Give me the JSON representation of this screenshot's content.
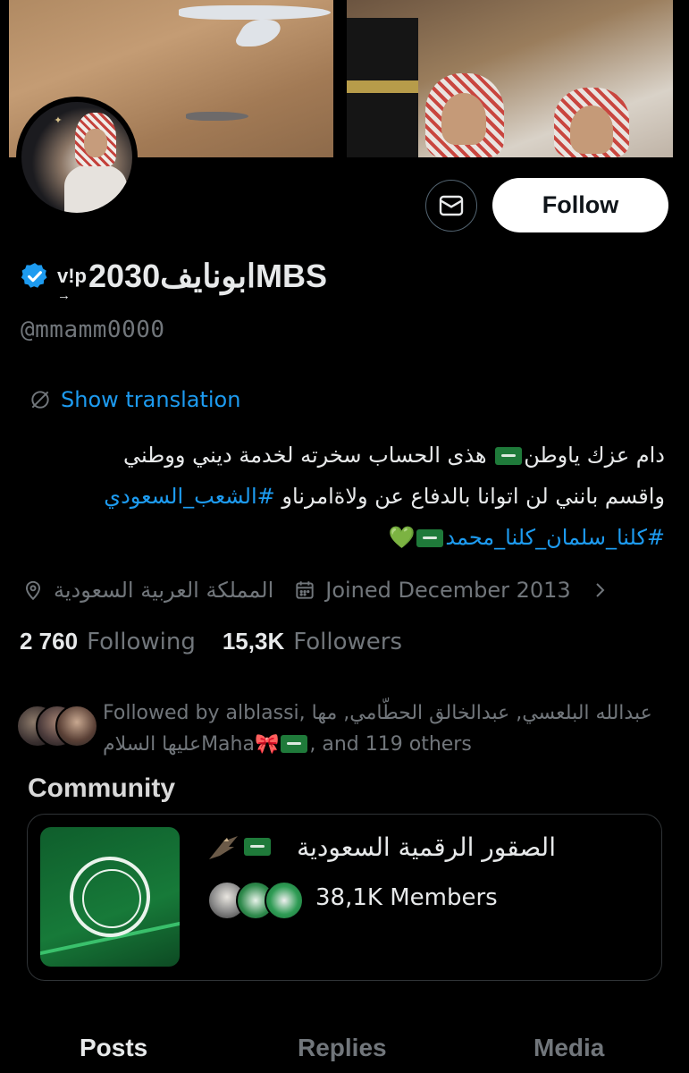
{
  "profile": {
    "display_name": "ابونايف2030MBS",
    "vip_tag": "v!p",
    "vip_arrow": "→",
    "handle": "@mmamm0000",
    "follow_label": "Follow",
    "translate_label": "Show translation",
    "bio": {
      "line1_a": "دام عزك ياوطن",
      "line1_b": "هذى الحساب سخرته لخدمة ديني ووطني",
      "line2_a": "واقسم بانني لن اتوانا بالدفاع عن ولاةامرناو",
      "line2_hashtag": "#الشعب_السعودي",
      "line3_hashtag": "#كلنا_سلمان_كلنا_محمد",
      "heart": "💚"
    },
    "location": "المملكة العربية السعودية",
    "joined": "Joined December 2013",
    "following_count": "2 760",
    "following_label": "Following",
    "followers_count": "15,3K",
    "followers_label": "Followers",
    "followed_by_line1": "Followed by alblassi, عبدالله البلعسي, عبدالخالق الحطّامي, مها",
    "followed_by_line2_a": "Maha",
    "followed_by_line2_b": "عليها السلام",
    "followed_by_line2_c": ", and 119 others",
    "ribbon": "🎀"
  },
  "community": {
    "section_title": "Community",
    "name": "الصقور الرقمية السعودية",
    "members": "38,1K Members"
  },
  "tabs": [
    "Posts",
    "Replies",
    "Media"
  ],
  "colors": {
    "background": "#000000",
    "accent_blue": "#1d9bf0",
    "muted": "#71767b",
    "text": "#e7e9ea",
    "verified": "#1d9bf0",
    "flag_green": "#1f7a3a"
  },
  "icons": [
    "mail-icon",
    "verified-badge-icon",
    "translate-icon",
    "location-pin-icon",
    "calendar-icon",
    "chevron-right-icon",
    "eagle-icon"
  ]
}
